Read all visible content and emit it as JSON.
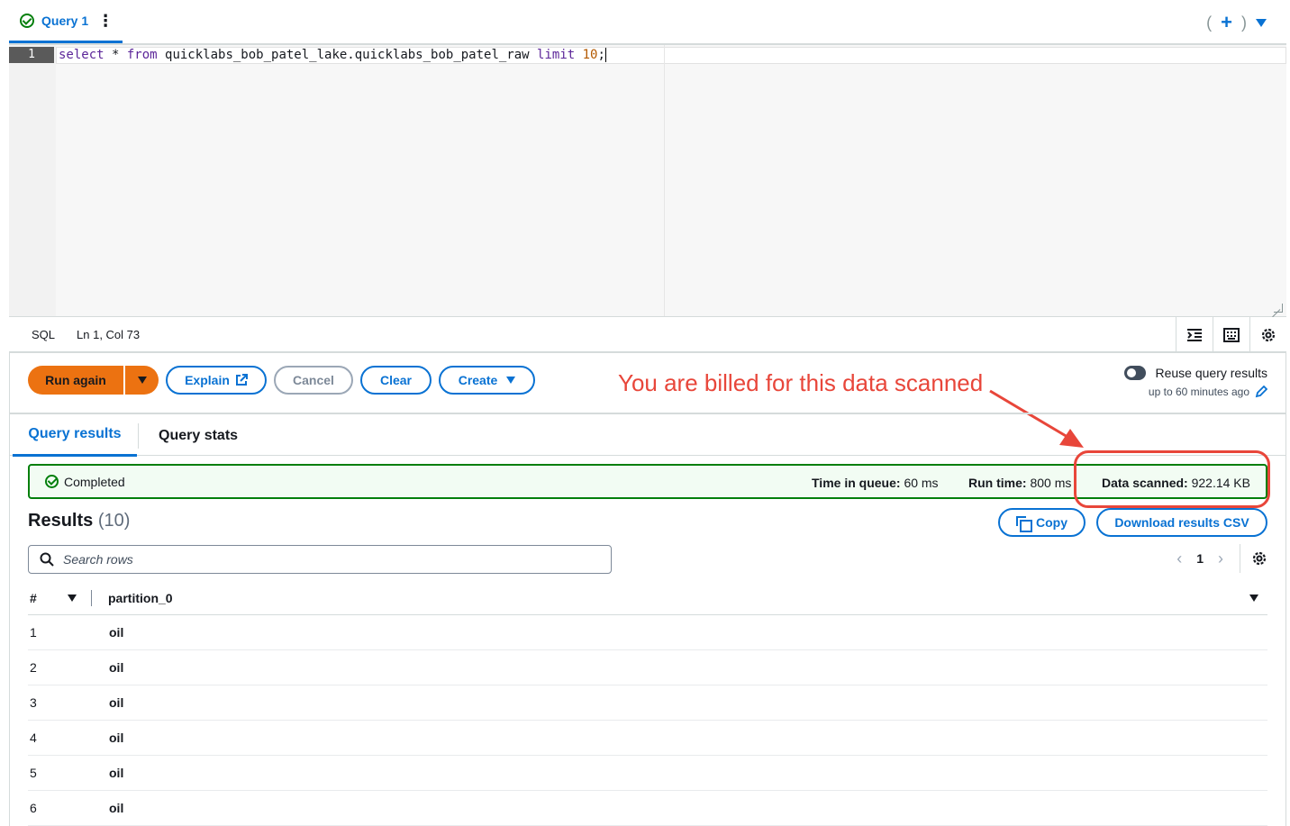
{
  "query_tab": {
    "label": "Query 1"
  },
  "editor": {
    "line_number": "1",
    "code": {
      "kw1": "select",
      "mid": " * ",
      "kw2": "from",
      "table": " quicklabs_bob_patel_lake.quicklabs_bob_patel_raw ",
      "kw3": "limit",
      "space": " ",
      "num": "10",
      "end": ";"
    }
  },
  "statusbar": {
    "language": "SQL",
    "position": "Ln 1, Col 73"
  },
  "actions": {
    "run_again": "Run again",
    "explain": "Explain",
    "cancel": "Cancel",
    "clear": "Clear",
    "create": "Create"
  },
  "annotation": {
    "text": "You are billed for this data scanned",
    "color": "#e8463a"
  },
  "reuse": {
    "label": "Reuse query results",
    "sub": "up to 60 minutes ago",
    "enabled": false
  },
  "result_tabs": {
    "results": "Query results",
    "stats": "Query stats"
  },
  "status": {
    "state": "Completed",
    "queue_label": "Time in queue:",
    "queue_value": "60 ms",
    "run_label": "Run time:",
    "run_value": "800 ms",
    "scanned_label": "Data scanned:",
    "scanned_value": "922.14 KB"
  },
  "results": {
    "title": "Results",
    "count": "(10)",
    "copy": "Copy",
    "download": "Download results CSV",
    "search_placeholder": "Search rows",
    "page": "1",
    "columns": {
      "num": "#",
      "col1": "partition_0"
    },
    "rows": [
      {
        "n": "1",
        "v": "oil"
      },
      {
        "n": "2",
        "v": "oil"
      },
      {
        "n": "3",
        "v": "oil"
      },
      {
        "n": "4",
        "v": "oil"
      },
      {
        "n": "5",
        "v": "oil"
      },
      {
        "n": "6",
        "v": "oil"
      }
    ]
  },
  "colors": {
    "primary": "#0972d3",
    "run": "#ec7211",
    "success": "#037f0c",
    "annotation": "#e8463a"
  },
  "icons": [
    "check-circle-icon",
    "kebab-icon",
    "plus-icon",
    "caret-down-icon",
    "external-link-icon",
    "pencil-icon",
    "copy-icon",
    "search-icon",
    "chevron-left-icon",
    "chevron-right-icon",
    "settings-icon",
    "indent-icon",
    "keyboard-icon",
    "filter-icon"
  ]
}
